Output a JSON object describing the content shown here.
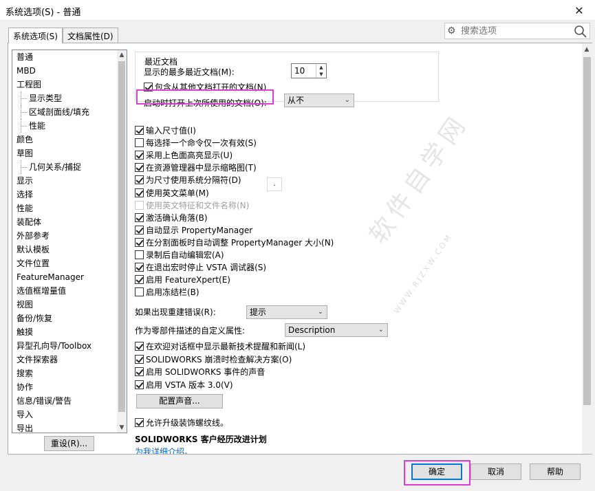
{
  "window": {
    "title": "系统选项(S) - 普通",
    "close_symbol": "✕"
  },
  "tabs": [
    {
      "label": "系统选项(S)",
      "active": true
    },
    {
      "label": "文档属性(D)",
      "active": false
    }
  ],
  "search": {
    "placeholder": "搜索选项",
    "value": ""
  },
  "tree": {
    "items": [
      {
        "label": "普通",
        "child": false
      },
      {
        "label": "MBD",
        "child": false
      },
      {
        "label": "工程图",
        "child": false
      },
      {
        "label": "显示类型",
        "child": true
      },
      {
        "label": "区域剖面线/填充",
        "child": true
      },
      {
        "label": "性能",
        "child": true
      },
      {
        "label": "颜色",
        "child": false
      },
      {
        "label": "草图",
        "child": false
      },
      {
        "label": "几何关系/捕捉",
        "child": true
      },
      {
        "label": "显示",
        "child": false
      },
      {
        "label": "选择",
        "child": false
      },
      {
        "label": "性能",
        "child": false
      },
      {
        "label": "装配体",
        "child": false
      },
      {
        "label": "外部参考",
        "child": false
      },
      {
        "label": "默认模板",
        "child": false
      },
      {
        "label": "文件位置",
        "child": false
      },
      {
        "label": "FeatureManager",
        "child": false
      },
      {
        "label": "选值框增量值",
        "child": false
      },
      {
        "label": "视图",
        "child": false
      },
      {
        "label": "备份/恢复",
        "child": false
      },
      {
        "label": "触摸",
        "child": false
      },
      {
        "label": "异型孔向导/Toolbox",
        "child": false
      },
      {
        "label": "文件探索器",
        "child": false
      },
      {
        "label": "搜索",
        "child": false
      },
      {
        "label": "协作",
        "child": false
      },
      {
        "label": "信息/错误/警告",
        "child": false
      },
      {
        "label": "导入",
        "child": false
      },
      {
        "label": "导出",
        "child": false
      }
    ],
    "reset_label": "重设(R)..."
  },
  "recent": {
    "group_title": "最近文档",
    "max_label": "显示的最多最近文档(M):",
    "max_value": "10",
    "include_label": "包含从其他文档打开的文档(N)",
    "include_checked": true,
    "startup_label": "启动时打开上次所使用的文档(O):",
    "startup_value": "从不"
  },
  "options": [
    {
      "label": "输入尺寸值(I)",
      "checked": true,
      "disabled": false
    },
    {
      "label": "每选择一个命令仅一次有效(S)",
      "checked": false,
      "disabled": false
    },
    {
      "label": "采用上色面高亮显示(U)",
      "checked": true,
      "disabled": false
    },
    {
      "label": "在资源管理器中显示缩略图(T)",
      "checked": true,
      "disabled": false
    },
    {
      "label": "为尺寸使用系统分隔符(D)",
      "checked": true,
      "disabled": false
    },
    {
      "label": "使用英文菜单(M)",
      "checked": true,
      "disabled": false
    },
    {
      "label": "使用英文特征和文件名称(N)",
      "checked": false,
      "disabled": true
    },
    {
      "label": "激活确认角落(B)",
      "checked": true,
      "disabled": false
    },
    {
      "label": "自动显示 PropertyManager",
      "checked": true,
      "disabled": false
    },
    {
      "label": "在分割面板时自动调整 PropertyManager 大小(N)",
      "checked": true,
      "disabled": false
    },
    {
      "label": "录制后自动编辑宏(A)",
      "checked": false,
      "disabled": false
    },
    {
      "label": "在退出宏时停止 VSTA 调试器(S)",
      "checked": true,
      "disabled": false
    },
    {
      "label": "启用 FeatureXpert(E)",
      "checked": true,
      "disabled": false
    },
    {
      "label": "启用冻结栏(B)",
      "checked": false,
      "disabled": false
    }
  ],
  "separator_value": ".",
  "rebuild": {
    "label": "如果出现重建错误(R):",
    "value": "提示"
  },
  "custom_prop": {
    "label": "作为零部件描述的自定义属性:",
    "value": "Description"
  },
  "options2": [
    {
      "label": "在欢迎对话框中显示最新技术提醒和新闻(L)",
      "checked": true
    },
    {
      "label": "SOLIDWORKS 崩溃时检查解决方案(O)",
      "checked": true
    },
    {
      "label": "启用 SOLIDWORKS 事件的声音",
      "checked": true
    },
    {
      "label": "启用 VSTA 版本 3.0(V)",
      "checked": true
    }
  ],
  "sound_button": "配置声音...",
  "thread_option": {
    "label": "允许升级装饰螺纹线。",
    "checked": true
  },
  "program": {
    "title": "SOLIDWORKS 客户经历改进计划",
    "link": "为我详细介绍。"
  },
  "footer": {
    "ok": "确定",
    "cancel": "取消",
    "help": "帮助"
  },
  "watermark": {
    "text": "软件自学网",
    "url": "WWW.RJZXW.COM"
  },
  "colors": {
    "highlight": "#e03ad8",
    "link": "#0066cc"
  }
}
